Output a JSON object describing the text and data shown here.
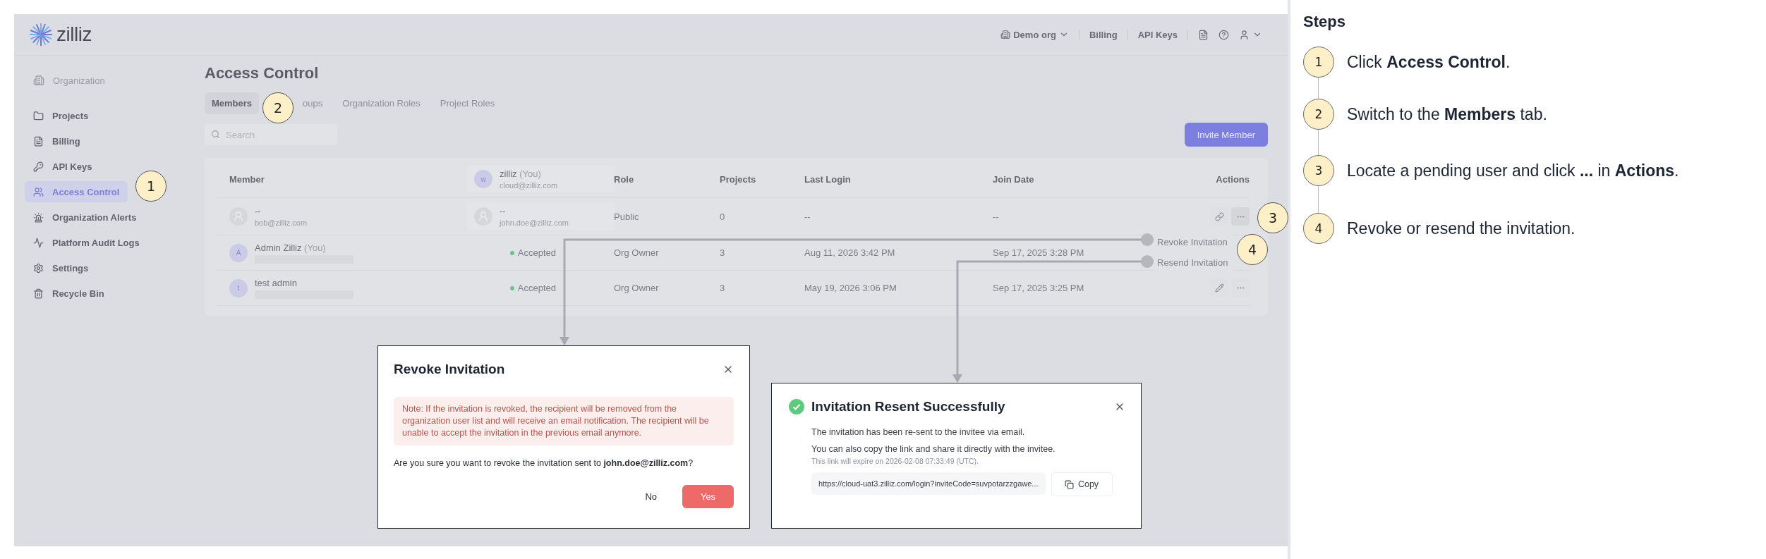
{
  "logo": {
    "text": "zilliz"
  },
  "header": {
    "org": "Demo org",
    "links": [
      "Billing",
      "API Keys"
    ]
  },
  "sidebar": {
    "section": "Organization",
    "items": [
      {
        "label": "Projects",
        "selected": false
      },
      {
        "label": "Billing",
        "selected": false
      },
      {
        "label": "API Keys",
        "selected": false
      },
      {
        "label": "Access Control",
        "selected": true
      },
      {
        "label": "Organization Alerts",
        "selected": false
      },
      {
        "label": "Platform Audit Logs",
        "selected": false
      },
      {
        "label": "Settings",
        "selected": false
      },
      {
        "label": "Recycle Bin",
        "selected": false
      }
    ]
  },
  "page_title": "Access Control",
  "tabs": [
    {
      "label": "Members",
      "selected": true
    },
    {
      "label": "oups",
      "selected": false
    },
    {
      "label": "Organization Roles",
      "selected": false
    },
    {
      "label": "Project Roles",
      "selected": false
    }
  ],
  "search": {
    "placeholder": "Search"
  },
  "invite_button": "Invite Member",
  "table": {
    "columns": [
      {
        "kind": "text",
        "label": "Member"
      },
      {
        "kind": "user",
        "avatar": "w",
        "name": "zilliz",
        "tag": "(You)",
        "email": "cloud@zilliz.com"
      },
      {
        "kind": "text",
        "label": "Role"
      },
      {
        "kind": "text",
        "label": "Projects"
      },
      {
        "kind": "text",
        "label": "Last Login"
      },
      {
        "kind": "text",
        "label": "Join Date"
      },
      {
        "kind": "text",
        "label": "Actions"
      }
    ],
    "rows": [
      {
        "member": {
          "kind": "pending",
          "name": "--",
          "email": "bob@zilliz.com"
        },
        "status": {
          "kind": "user",
          "name": "--",
          "email": "john.doe@zilliz.com"
        },
        "role": "Public",
        "projects": "0",
        "last_login": "--",
        "join_date": "--",
        "actions_shown": true
      },
      {
        "member": {
          "kind": "active",
          "avatar": "A",
          "name": "Admin Zilliz",
          "tag": "(You)"
        },
        "status": {
          "kind": "status",
          "text": "Accepted"
        },
        "role": "Org Owner",
        "projects": "3",
        "last_login": "Aug 11, 2026 3:42 PM",
        "join_date": "Sep 17, 2025 3:28 PM"
      },
      {
        "member": {
          "kind": "active",
          "avatar": "t",
          "name": "test admin"
        },
        "status": {
          "kind": "status",
          "text": "Accepted"
        },
        "role": "Org Owner",
        "projects": "3",
        "last_login": "May 19, 2026 3:06 PM",
        "join_date": "Sep 17, 2025 3:25 PM",
        "actions_shown": true
      }
    ]
  },
  "menu": {
    "items": [
      "Revoke Invitation",
      "Resend Invitation"
    ]
  },
  "callouts": [
    "1",
    "2",
    "3",
    "4"
  ],
  "revoke_dialog": {
    "title": "Revoke Invitation",
    "note": "Note: If the invitation is revoked, the recipient will be removed from the organization user list and will receive an email notification. The recipient will be unable to accept the invitation in the previous email anymore.",
    "question": "Are you sure you want to revoke the invitation sent to **john.doe@zilliz.com**?",
    "buttons": [
      "No",
      "Yes"
    ]
  },
  "resent_dialog": {
    "title": "Invitation Resent Successfully",
    "lines": [
      "The invitation has been re-sent to the invitee via email.",
      "You can also copy the link and share it directly with the invitee."
    ],
    "expiry": "This link will expire on 2026-02-08 07:33:49 (UTC).",
    "link": "https://cloud-uat3.zilliz.com/login?inviteCode=suvpotarzzgawe...",
    "copy_button": "Copy"
  },
  "steps": {
    "title": "Steps",
    "items": [
      {
        "number": "1",
        "text": "Click **Access Control**."
      },
      {
        "number": "2",
        "text": "Switch to the **Members** tab."
      },
      {
        "number": "3",
        "text": "Locate a pending user and click **...** in **Actions**."
      },
      {
        "number": "4",
        "text": "Revoke or resend the invitation."
      }
    ]
  }
}
